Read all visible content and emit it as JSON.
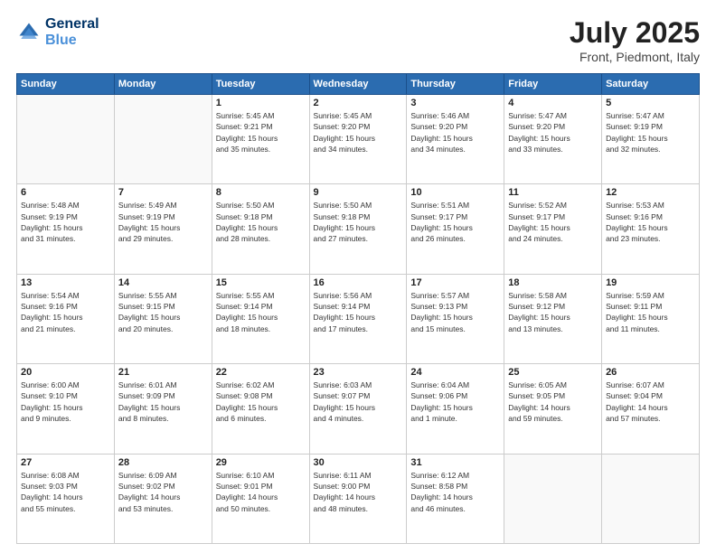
{
  "header": {
    "logo_line1": "General",
    "logo_line2": "Blue",
    "title": "July 2025",
    "subtitle": "Front, Piedmont, Italy"
  },
  "weekdays": [
    "Sunday",
    "Monday",
    "Tuesday",
    "Wednesday",
    "Thursday",
    "Friday",
    "Saturday"
  ],
  "weeks": [
    [
      {
        "num": "",
        "info": ""
      },
      {
        "num": "",
        "info": ""
      },
      {
        "num": "1",
        "info": "Sunrise: 5:45 AM\nSunset: 9:21 PM\nDaylight: 15 hours\nand 35 minutes."
      },
      {
        "num": "2",
        "info": "Sunrise: 5:45 AM\nSunset: 9:20 PM\nDaylight: 15 hours\nand 34 minutes."
      },
      {
        "num": "3",
        "info": "Sunrise: 5:46 AM\nSunset: 9:20 PM\nDaylight: 15 hours\nand 34 minutes."
      },
      {
        "num": "4",
        "info": "Sunrise: 5:47 AM\nSunset: 9:20 PM\nDaylight: 15 hours\nand 33 minutes."
      },
      {
        "num": "5",
        "info": "Sunrise: 5:47 AM\nSunset: 9:19 PM\nDaylight: 15 hours\nand 32 minutes."
      }
    ],
    [
      {
        "num": "6",
        "info": "Sunrise: 5:48 AM\nSunset: 9:19 PM\nDaylight: 15 hours\nand 31 minutes."
      },
      {
        "num": "7",
        "info": "Sunrise: 5:49 AM\nSunset: 9:19 PM\nDaylight: 15 hours\nand 29 minutes."
      },
      {
        "num": "8",
        "info": "Sunrise: 5:50 AM\nSunset: 9:18 PM\nDaylight: 15 hours\nand 28 minutes."
      },
      {
        "num": "9",
        "info": "Sunrise: 5:50 AM\nSunset: 9:18 PM\nDaylight: 15 hours\nand 27 minutes."
      },
      {
        "num": "10",
        "info": "Sunrise: 5:51 AM\nSunset: 9:17 PM\nDaylight: 15 hours\nand 26 minutes."
      },
      {
        "num": "11",
        "info": "Sunrise: 5:52 AM\nSunset: 9:17 PM\nDaylight: 15 hours\nand 24 minutes."
      },
      {
        "num": "12",
        "info": "Sunrise: 5:53 AM\nSunset: 9:16 PM\nDaylight: 15 hours\nand 23 minutes."
      }
    ],
    [
      {
        "num": "13",
        "info": "Sunrise: 5:54 AM\nSunset: 9:16 PM\nDaylight: 15 hours\nand 21 minutes."
      },
      {
        "num": "14",
        "info": "Sunrise: 5:55 AM\nSunset: 9:15 PM\nDaylight: 15 hours\nand 20 minutes."
      },
      {
        "num": "15",
        "info": "Sunrise: 5:55 AM\nSunset: 9:14 PM\nDaylight: 15 hours\nand 18 minutes."
      },
      {
        "num": "16",
        "info": "Sunrise: 5:56 AM\nSunset: 9:14 PM\nDaylight: 15 hours\nand 17 minutes."
      },
      {
        "num": "17",
        "info": "Sunrise: 5:57 AM\nSunset: 9:13 PM\nDaylight: 15 hours\nand 15 minutes."
      },
      {
        "num": "18",
        "info": "Sunrise: 5:58 AM\nSunset: 9:12 PM\nDaylight: 15 hours\nand 13 minutes."
      },
      {
        "num": "19",
        "info": "Sunrise: 5:59 AM\nSunset: 9:11 PM\nDaylight: 15 hours\nand 11 minutes."
      }
    ],
    [
      {
        "num": "20",
        "info": "Sunrise: 6:00 AM\nSunset: 9:10 PM\nDaylight: 15 hours\nand 9 minutes."
      },
      {
        "num": "21",
        "info": "Sunrise: 6:01 AM\nSunset: 9:09 PM\nDaylight: 15 hours\nand 8 minutes."
      },
      {
        "num": "22",
        "info": "Sunrise: 6:02 AM\nSunset: 9:08 PM\nDaylight: 15 hours\nand 6 minutes."
      },
      {
        "num": "23",
        "info": "Sunrise: 6:03 AM\nSunset: 9:07 PM\nDaylight: 15 hours\nand 4 minutes."
      },
      {
        "num": "24",
        "info": "Sunrise: 6:04 AM\nSunset: 9:06 PM\nDaylight: 15 hours\nand 1 minute."
      },
      {
        "num": "25",
        "info": "Sunrise: 6:05 AM\nSunset: 9:05 PM\nDaylight: 14 hours\nand 59 minutes."
      },
      {
        "num": "26",
        "info": "Sunrise: 6:07 AM\nSunset: 9:04 PM\nDaylight: 14 hours\nand 57 minutes."
      }
    ],
    [
      {
        "num": "27",
        "info": "Sunrise: 6:08 AM\nSunset: 9:03 PM\nDaylight: 14 hours\nand 55 minutes."
      },
      {
        "num": "28",
        "info": "Sunrise: 6:09 AM\nSunset: 9:02 PM\nDaylight: 14 hours\nand 53 minutes."
      },
      {
        "num": "29",
        "info": "Sunrise: 6:10 AM\nSunset: 9:01 PM\nDaylight: 14 hours\nand 50 minutes."
      },
      {
        "num": "30",
        "info": "Sunrise: 6:11 AM\nSunset: 9:00 PM\nDaylight: 14 hours\nand 48 minutes."
      },
      {
        "num": "31",
        "info": "Sunrise: 6:12 AM\nSunset: 8:58 PM\nDaylight: 14 hours\nand 46 minutes."
      },
      {
        "num": "",
        "info": ""
      },
      {
        "num": "",
        "info": ""
      }
    ]
  ]
}
